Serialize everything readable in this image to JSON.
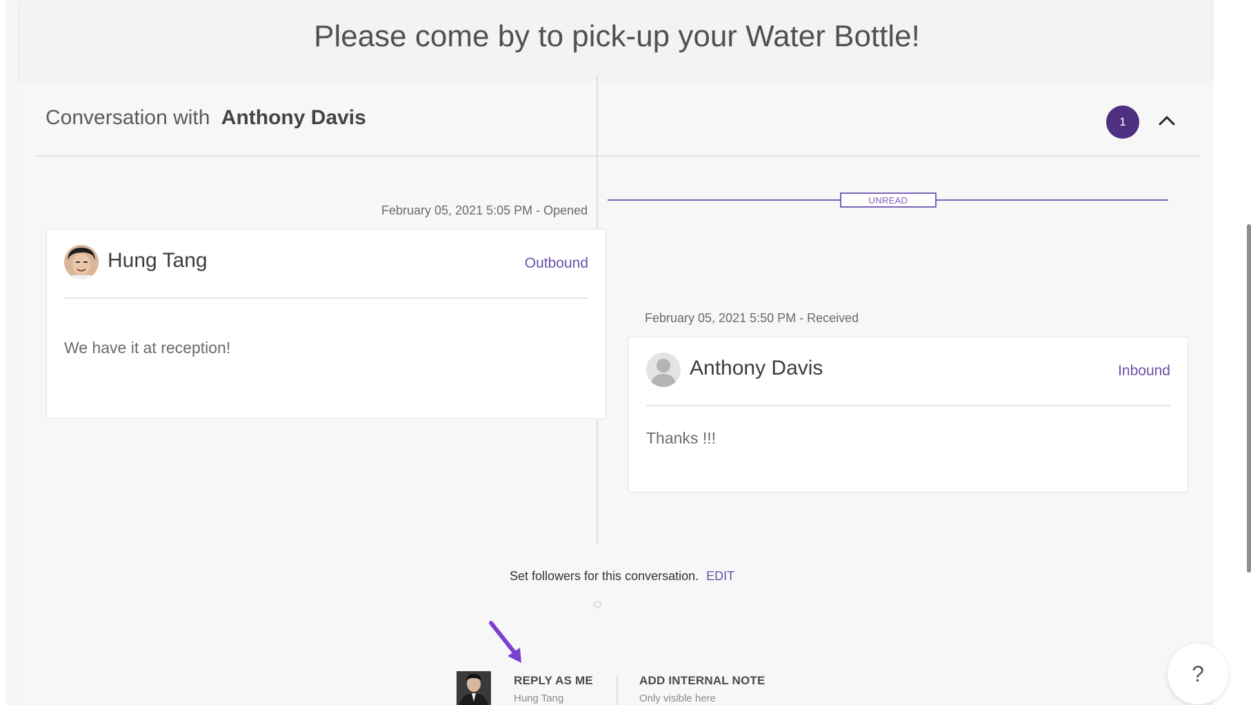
{
  "subject": {
    "title": "Please come by to pick-up your Water Bottle!"
  },
  "conversation": {
    "prefix": "Conversation with",
    "contact_name": "Anthony Davis",
    "message_count": "1",
    "collapse_icon": "chevron-up-icon"
  },
  "messages": [
    {
      "meta": "February 05, 2021 5:05 PM - Opened",
      "sender": "Hung Tang",
      "direction": "Outbound",
      "body": "We have it at reception!",
      "avatar": "user-photo-avatar"
    },
    {
      "meta": "February 05, 2021 5:50 PM - Received",
      "sender": "Anthony Davis",
      "direction": "Inbound",
      "body": "Thanks !!!",
      "avatar": "default-person-avatar"
    }
  ],
  "unread_label": "UNREAD",
  "followers": {
    "text": "Set followers for this conversation.",
    "edit_label": "EDIT"
  },
  "actions": {
    "reply_label": "REPLY AS ME",
    "reply_sub": "Hung Tang",
    "note_label": "ADD INTERNAL NOTE",
    "note_sub": "Only visible here"
  },
  "help": {
    "label": "?"
  },
  "colors": {
    "accent": "#6b4fa8",
    "badge": "#4e2f80",
    "annotation_arrow": "#7a3fd1"
  }
}
